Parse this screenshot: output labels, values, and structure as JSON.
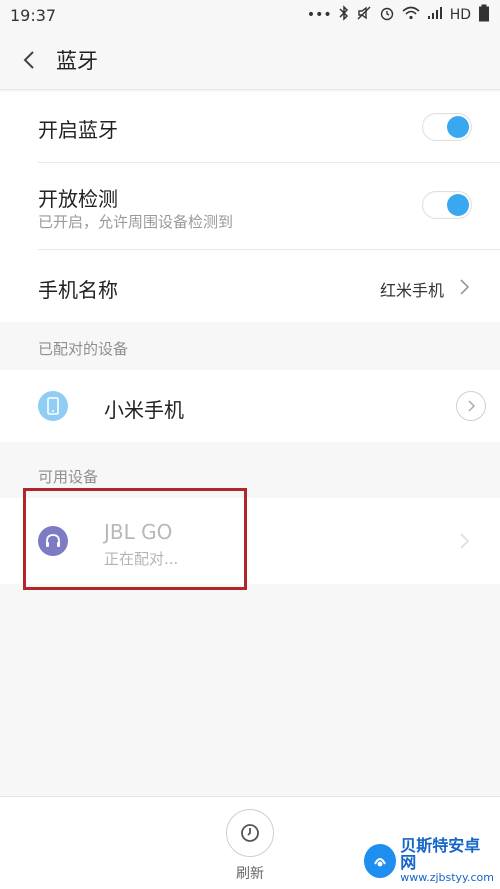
{
  "status_bar": {
    "time": "19:37",
    "net_label": "HD"
  },
  "header": {
    "title": "蓝牙"
  },
  "settings": {
    "bluetooth": {
      "label": "开启蓝牙",
      "enabled": true
    },
    "discoverable": {
      "label": "开放检测",
      "subtitle": "已开启，允许周围设备检测到",
      "enabled": true
    },
    "phone_name": {
      "label": "手机名称",
      "value": "红米手机"
    }
  },
  "paired_section": {
    "title": "已配对的设备",
    "devices": [
      {
        "name": "小米手机",
        "icon": "phone-icon"
      }
    ]
  },
  "available_section": {
    "title": "可用设备",
    "devices": [
      {
        "name": "JBL GO",
        "status": "正在配对...",
        "icon": "headphones-icon"
      }
    ]
  },
  "bottom": {
    "refresh_label": "刷新"
  },
  "watermark": {
    "title": "贝斯特安卓网",
    "url": "www.zjbstyy.com"
  },
  "colors": {
    "accent": "#3aa8f0",
    "highlight": "#b1262b",
    "headphones_bg": "#7c7bc4",
    "phone_bg": "#8fcdf5"
  }
}
